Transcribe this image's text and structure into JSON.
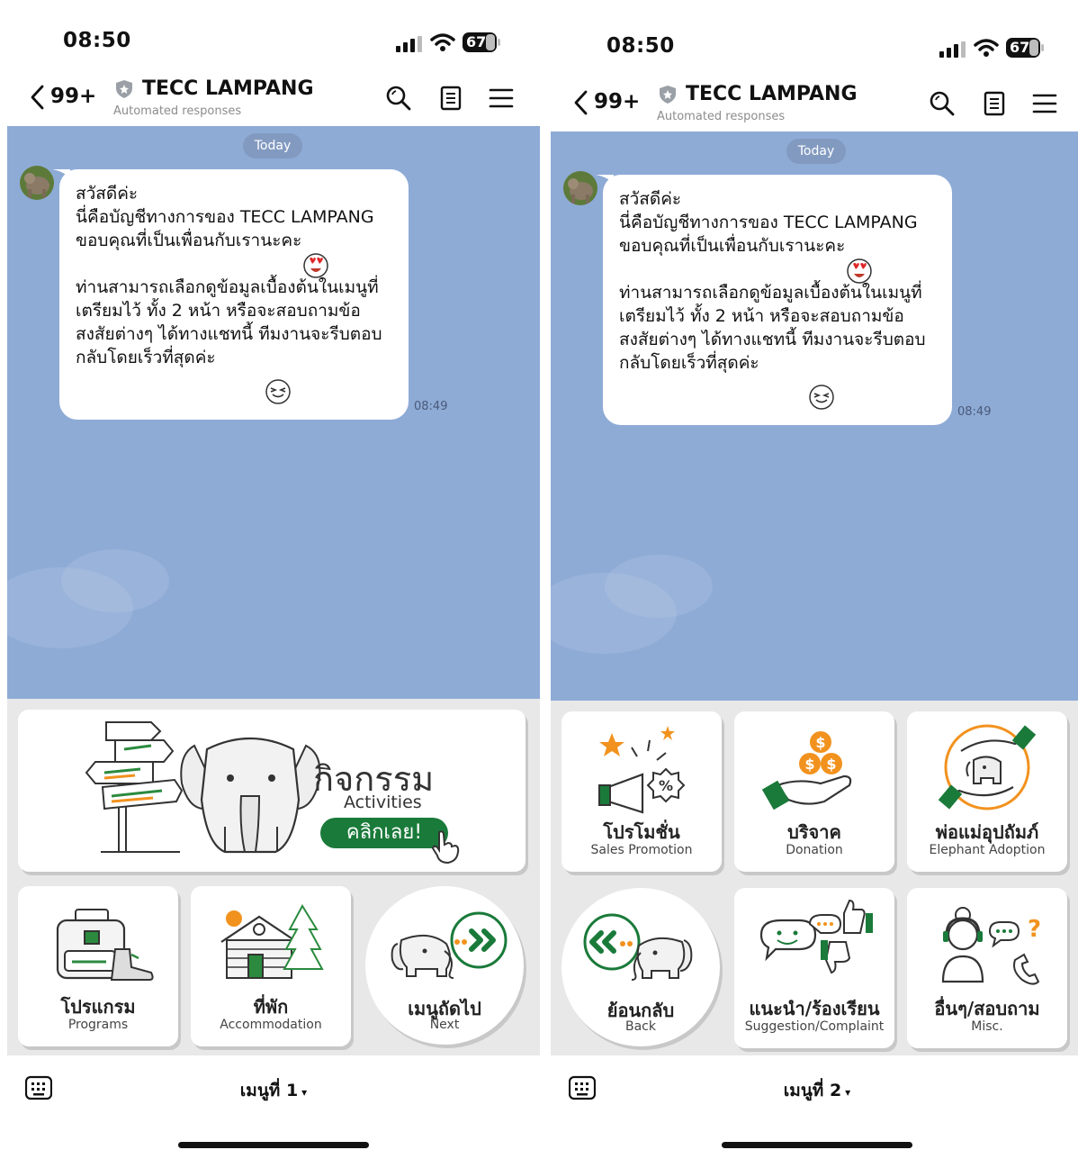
{
  "colors": {
    "chat_bg": "#8eabd6",
    "accent_green": "#1a7a3a",
    "accent_orange": "#f2921e"
  },
  "screens": [
    {
      "status": {
        "time": "08:50",
        "battery": "67"
      },
      "header": {
        "back_count": "99+",
        "title": "TECC LAMPANG",
        "subtitle": "Automated responses"
      },
      "chat": {
        "date_chip": "Today",
        "message": {
          "para1": "สวัสดีค่ะ\nนี่คือบัญชีทางการของ TECC LAMPANG\nขอบคุณที่เป็นเพื่อนกับเรานะคะ",
          "para2": "ท่านสามารถเลือกดูข้อมูลเบื้องต้นในเมนูที่เตรียมไว้ ทั้ง 2 หน้า หรือจะสอบถามข้อสงสัยต่างๆ ได้ทางแชทนี้ ทีมงานจะรีบตอบกลับโดยเร็วที่สุดค่ะ",
          "time": "08:49"
        }
      },
      "menu": {
        "activities": {
          "th": "กิจกรรม",
          "en": "Activities",
          "cta": "คลิกเลย!"
        },
        "programs": {
          "th": "โปรแกรม",
          "en": "Programs"
        },
        "accommodation": {
          "th": "ที่พัก",
          "en": "Accommodation"
        },
        "next": {
          "th": "เมนูถัดไป",
          "en": "Next"
        }
      },
      "bottom": {
        "menu_label": "เมนูที่ 1",
        "arrow": "▾"
      }
    },
    {
      "status": {
        "time": "08:50",
        "battery": "67"
      },
      "header": {
        "back_count": "99+",
        "title": "TECC LAMPANG",
        "subtitle": "Automated responses"
      },
      "chat": {
        "date_chip": "Today",
        "message": {
          "para1": "สวัสดีค่ะ\nนี่คือบัญชีทางการของ TECC LAMPANG\nขอบคุณที่เป็นเพื่อนกับเรานะคะ",
          "para2": "ท่านสามารถเลือกดูข้อมูลเบื้องต้นในเมนูที่เตรียมไว้ ทั้ง 2 หน้า หรือจะสอบถามข้อสงสัยต่างๆ ได้ทางแชทนี้ ทีมงานจะรีบตอบกลับโดยเร็วที่สุดค่ะ",
          "time": "08:49"
        }
      },
      "menu": {
        "promotion": {
          "th": "โปรโมชั่น",
          "en": "Sales Promotion"
        },
        "donation": {
          "th": "บริจาค",
          "en": "Donation"
        },
        "adoption": {
          "th": "พ่อแม่อุปถัมภ์",
          "en": "Elephant Adoption"
        },
        "back": {
          "th": "ย้อนกลับ",
          "en": "Back"
        },
        "suggestion": {
          "th": "แนะนำ/ร้องเรียน",
          "en": "Suggestion/Complaint"
        },
        "misc": {
          "th": "อื่นๆ/สอบถาม",
          "en": "Misc."
        }
      },
      "bottom": {
        "menu_label": "เมนูที่ 2",
        "arrow": "▾"
      }
    }
  ]
}
